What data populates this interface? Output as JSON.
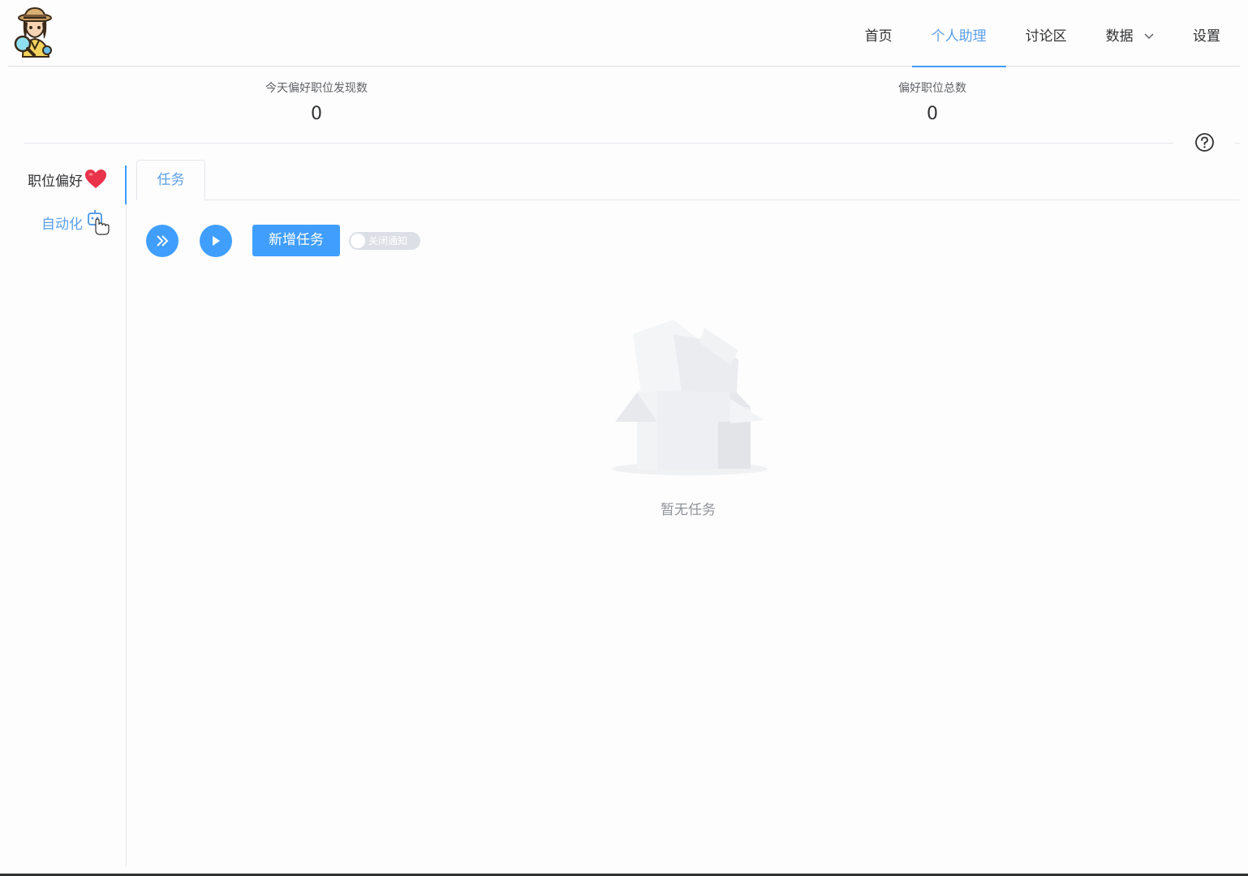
{
  "nav": {
    "items": [
      {
        "label": "首页",
        "active": false
      },
      {
        "label": "个人助理",
        "active": true
      },
      {
        "label": "讨论区",
        "active": false
      },
      {
        "label": "数据",
        "active": false,
        "dropdown": true
      },
      {
        "label": "设置",
        "active": false
      }
    ]
  },
  "stats": {
    "today_label": "今天偏好职位发现数",
    "today_value": "0",
    "total_label": "偏好职位总数",
    "total_value": "0"
  },
  "sidebar": {
    "items": [
      {
        "label": "职位偏好",
        "icon": "heart-icon",
        "active": false
      },
      {
        "label": "自动化",
        "icon": "robot-icon",
        "active": true
      }
    ]
  },
  "tabs": [
    {
      "label": "任务",
      "active": true
    }
  ],
  "toolbar": {
    "fast_forward_icon": "double-chevron-right-icon",
    "play_icon": "play-icon",
    "add_task_label": "新增任务",
    "switch_label": "关闭通知",
    "switch_on": false
  },
  "empty": {
    "icon": "empty-box-icon",
    "text": "暂无任务"
  },
  "colors": {
    "primary": "#409eff",
    "active_text": "#5b9fe8",
    "heart": "#e8334a"
  }
}
